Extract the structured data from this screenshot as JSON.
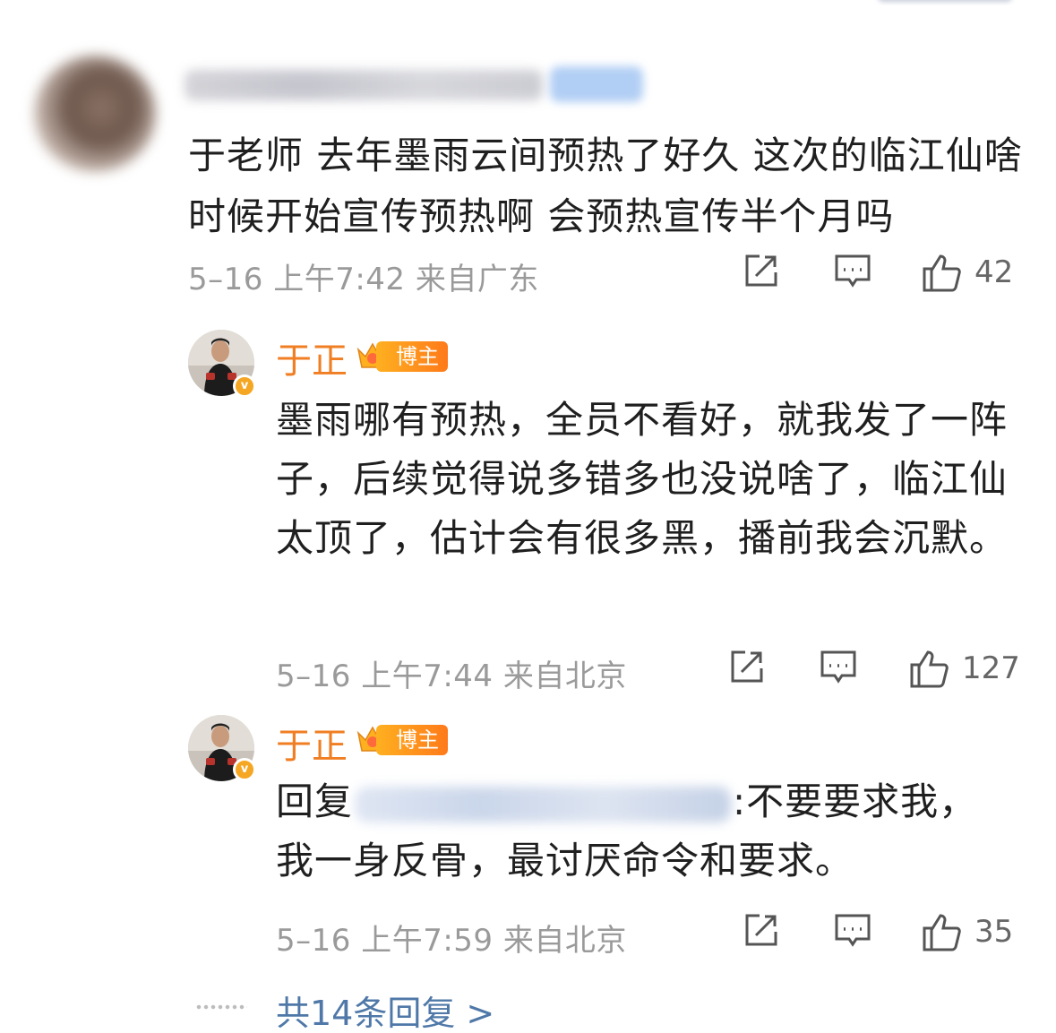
{
  "comment": {
    "text": "于老师 去年墨雨云间预热了好久 这次的临江仙啥时候开始宣传预热啊 会预热宣传半个月吗",
    "meta": "5–16 上午7:42 来自广东",
    "likes": "42"
  },
  "replies": [
    {
      "name": "于正",
      "badge": "博主",
      "text": "墨雨哪有预热，全员不看好，就我发了一阵子，后续觉得说多错多也没说啥了，临江仙太顶了，估计会有很多黑，播前我会沉默。",
      "meta": "5–16 上午7:44 来自北京",
      "likes": "127"
    },
    {
      "name": "于正",
      "badge": "博主",
      "reply_prefix": "回复",
      "text": ":不要要求我，我一身反骨，最讨厌命令和要求。",
      "meta": "5–16 上午7:59 来自北京",
      "likes": "35"
    }
  ],
  "more_replies": "共14条回复 >",
  "colors": {
    "name": "#f07e23",
    "link": "#4f78a8",
    "meta": "#9a9a9a"
  },
  "icons": [
    "share-icon",
    "comment-icon",
    "like-icon",
    "crown-icon",
    "verified-icon"
  ]
}
